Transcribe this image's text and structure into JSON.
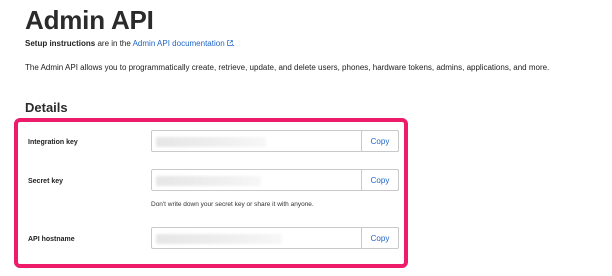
{
  "page": {
    "title": "Admin API",
    "setup": {
      "bold": "Setup instructions",
      "middle": " are in the ",
      "link": "Admin API documentation",
      "end": "."
    },
    "description": "The Admin API allows you to programmatically create, retrieve, update, and delete users, phones, hardware tokens, admins, applications, and more.",
    "section_title": "Details"
  },
  "details": {
    "integration_key": {
      "label": "Integration key",
      "copy": "Copy"
    },
    "secret_key": {
      "label": "Secret key",
      "copy": "Copy",
      "hint": "Don't write down your secret key or share it with anyone."
    },
    "api_hostname": {
      "label": "API hostname",
      "copy": "Copy"
    }
  },
  "colors": {
    "highlight": "#ee1b6b",
    "link": "#1f64c8"
  },
  "icons": {
    "external_link": "external-link-icon"
  }
}
